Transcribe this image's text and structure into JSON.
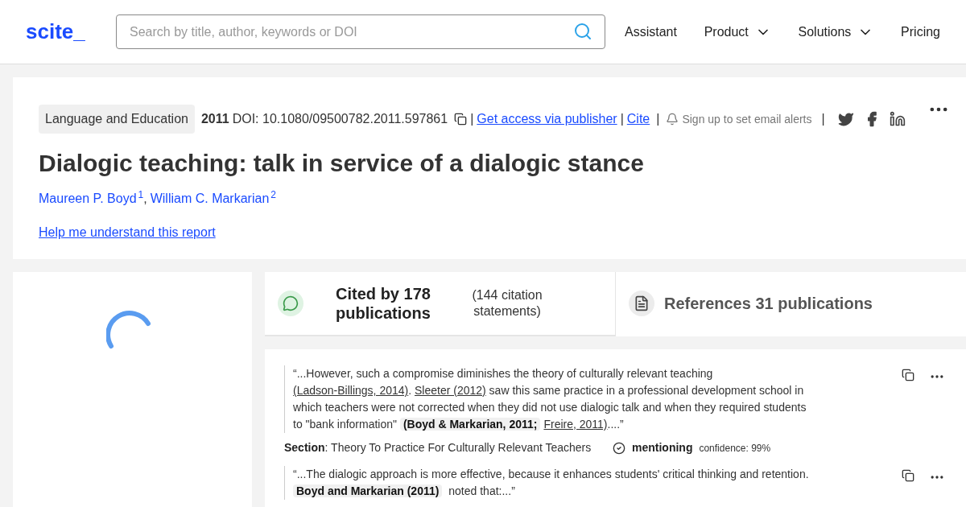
{
  "header": {
    "logo": "scite_",
    "search": {
      "placeholder": "Search by title, author, keywords or DOI"
    },
    "nav": [
      {
        "label": "Assistant",
        "dropdown": false
      },
      {
        "label": "Product",
        "dropdown": true
      },
      {
        "label": "Solutions",
        "dropdown": true
      },
      {
        "label": "Pricing",
        "dropdown": false
      }
    ]
  },
  "paper": {
    "journal": "Language and Education",
    "year": "2011",
    "doi": "DOI: 10.1080/09500782.2011.597861",
    "sep": "|",
    "access": "Get access via publisher",
    "cite": "Cite",
    "alerts": "Sign up to set email alerts",
    "title": "Dialogic teaching: talk in service of a dialogic stance",
    "authors": [
      {
        "name": "Maureen P. Boyd",
        "sup": "1"
      },
      {
        "name": "William C. Markarian",
        "sup": "2"
      }
    ],
    "author_sep": ",",
    "help": "Help me understand this report"
  },
  "tabs": [
    {
      "kind": "cited",
      "label": "Cited by 178 publications",
      "note": "(144 citation statements)",
      "selected": true
    },
    {
      "kind": "references",
      "label": "References 31 publications",
      "selected": false
    }
  ],
  "citations": [
    {
      "segments": [
        {
          "kind": "text",
          "text": "“...However, such a compromise diminishes the theory of culturally relevant teaching "
        },
        {
          "kind": "link",
          "text": "(Ladson-Billings, 2014)"
        },
        {
          "kind": "text",
          "text": ". "
        },
        {
          "kind": "link",
          "text": "Sleeter (2012)"
        },
        {
          "kind": "text",
          "text": " saw this same practice in a professional development school in which teachers were not corrected when they did not use dialogic talk and when they required students to \"bank information\" "
        },
        {
          "kind": "highlight",
          "text": "(Boyd & Markarian, 2011;"
        },
        {
          "kind": "link",
          "text": "Freire, 2011)"
        },
        {
          "kind": "text",
          "text": "....”"
        }
      ],
      "section_label": "Section",
      "section": ": Theory To Practice For Culturally Relevant Teachers",
      "type": "mentioning",
      "confidence": "confidence: 99%"
    },
    {
      "segments": [
        {
          "kind": "text",
          "text": "“...The dialogic approach is more effective, because it enhances students' critical thinking and retention. "
        },
        {
          "kind": "highlight",
          "text": "Boyd and Markarian (2011)"
        },
        {
          "kind": "text",
          "text": " noted that:...”"
        }
      ]
    }
  ]
}
